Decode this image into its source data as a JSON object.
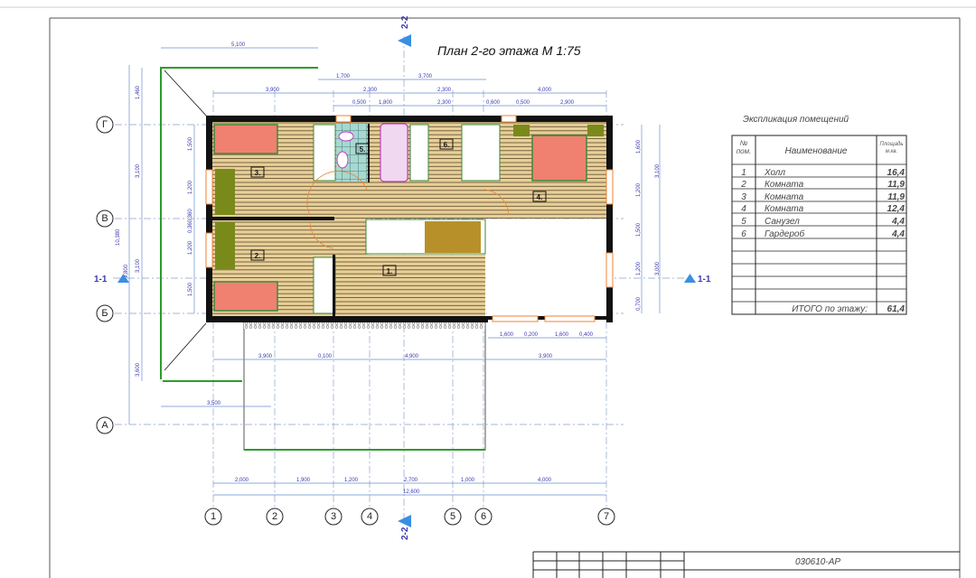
{
  "title": "План 2-го этажа  М 1:75",
  "stamp_code": "030610-АР",
  "section_marks": {
    "vertical": "2-2",
    "horizontal": "1-1"
  },
  "axes": {
    "columns": [
      "1",
      "2",
      "3",
      "4",
      "5",
      "6",
      "7"
    ],
    "rows": [
      "Г",
      "В",
      "Б",
      "А"
    ]
  },
  "dimensions": {
    "top": [
      "5,100",
      "1,700",
      "3,700",
      "3,900",
      "2,300",
      "2,300",
      "4,000",
      "0,500",
      "1,800",
      "2,300",
      "0,600",
      "0,500",
      "2,900"
    ],
    "bottom": [
      "1,600",
      "0,200",
      "1,600",
      "0,400",
      "3,900",
      "0,100",
      "4,900",
      "3,900",
      "3,500",
      "2,000",
      "1,900",
      "1,200",
      "2,700",
      "1,000",
      "4,000",
      "12,600"
    ],
    "left": [
      "1,460",
      "3,100",
      "3,100",
      "3,600",
      "10,380",
      "9,800",
      "1,500",
      "1,200",
      "0,360,360",
      "1,200",
      "1,500"
    ],
    "right": [
      "1,600",
      "1,200",
      "1,500",
      "1,200",
      "0,700",
      "3,100",
      "3,000"
    ]
  },
  "room_tags": [
    "1.",
    "2.",
    "3.",
    "4.",
    "5.",
    "6."
  ],
  "explication": {
    "title": "Экспликация помещений",
    "headers": {
      "num": "№ пом.",
      "name": "Наименование",
      "area": "Площадь м.кв."
    },
    "rows": [
      {
        "num": "1",
        "name": "Холл",
        "area": "16,4"
      },
      {
        "num": "2",
        "name": "Комната",
        "area": "11,9"
      },
      {
        "num": "3",
        "name": "Комната",
        "area": "11,9"
      },
      {
        "num": "4",
        "name": "Комната",
        "area": "12,4"
      },
      {
        "num": "5",
        "name": "Санузел",
        "area": "4,4"
      },
      {
        "num": "6",
        "name": "Гардероб",
        "area": "4,4"
      }
    ],
    "total_label": "ИТОГО по этажу:",
    "total_value": "61,4"
  },
  "colors": {
    "floor": "#e8cf98",
    "bed": "#f08070",
    "furniture": "#7a8a1a",
    "rail": "#2e9a2e",
    "window": "#f08030",
    "dim": "#3a3ab0",
    "section": "#3a8fe0"
  }
}
